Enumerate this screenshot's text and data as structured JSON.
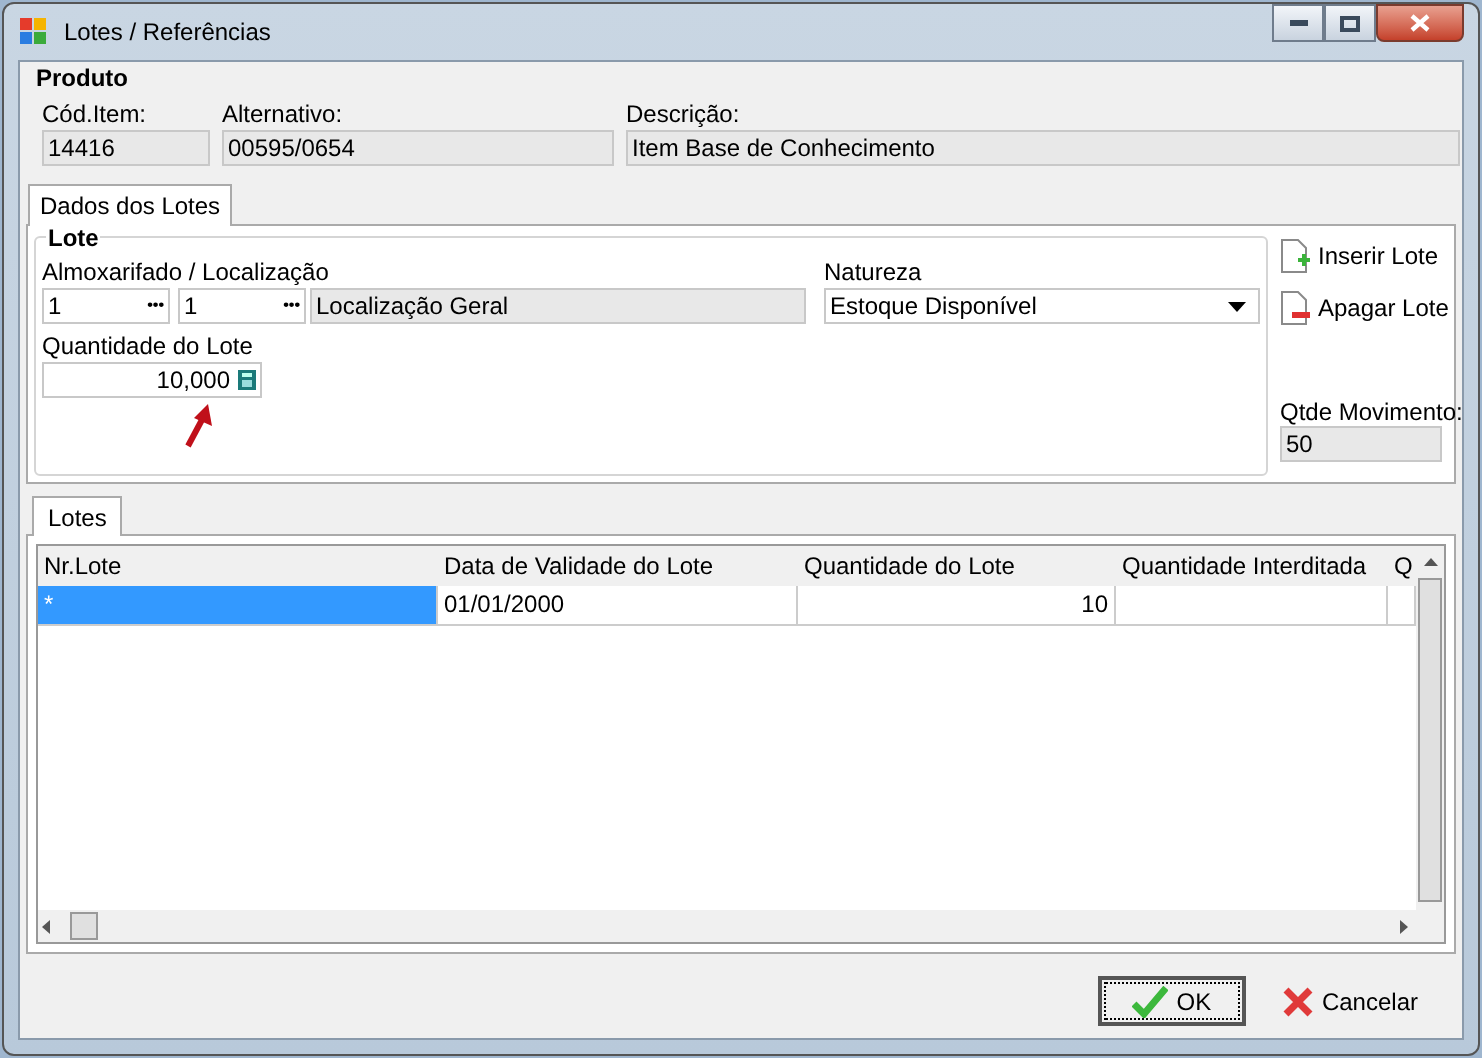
{
  "window": {
    "title": "Lotes / Referências"
  },
  "produto": {
    "title": "Produto",
    "fields": [
      {
        "label": "Cód.Item:",
        "value": "14416"
      },
      {
        "label": "Alternativo:",
        "value": "00595/0654"
      },
      {
        "label": "Descrição:",
        "value": "Item Base de Conhecimento"
      }
    ]
  },
  "tabs": [
    {
      "label": "Dados dos Lotes",
      "selected": true
    }
  ],
  "lote": {
    "title": "Lote",
    "almox_label": "Almoxarifado / Localização",
    "almox_value": "1",
    "local_value": "1",
    "ellipsis": "•••",
    "local_desc": "Localização Geral",
    "natureza_label": "Natureza",
    "natureza_value": "Estoque Disponível",
    "quantidade_label": "Quantidade do Lote",
    "quantidade_value": "10,000"
  },
  "actions": [
    {
      "label": "Inserir Lote",
      "kind": "insert"
    },
    {
      "label": "Apagar Lote",
      "kind": "delete"
    }
  ],
  "movimento": {
    "label": "Qtde Movimento:",
    "value": "50"
  },
  "grid_tabs": [
    {
      "label": "Lotes",
      "selected": true
    }
  ],
  "table": {
    "columns": [
      "Nr.Lote",
      "Data de Validade do Lote",
      "Quantidade do Lote",
      "Quantidade Interditada",
      "Q"
    ],
    "rows": [
      {
        "selected": true,
        "cells": [
          "*",
          "01/01/2000",
          "10"
        ]
      }
    ]
  },
  "buttons": [
    {
      "label": "OK",
      "kind": "ok",
      "focused": true
    },
    {
      "label": "Cancelar",
      "kind": "cancel",
      "focused": false
    }
  ]
}
